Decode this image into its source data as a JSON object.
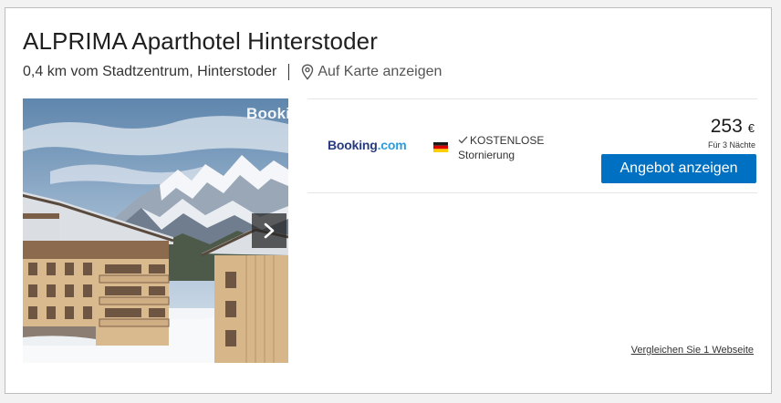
{
  "hotel": {
    "name": "ALPRIMA Aparthotel Hinterstoder",
    "distance": "0,4 km vom Stadtzentrum, Hinterstoder",
    "map_link": "Auf Karte anzeigen"
  },
  "photo": {
    "watermark": "Booki",
    "next_icon": "chevron-right-icon"
  },
  "offer": {
    "provider": {
      "name_main": "Booking",
      "name_suffix": ".com"
    },
    "flag": "germany-flag-icon",
    "cancellation_line1": "KOSTENLOSE",
    "cancellation_line2": "Stornierung",
    "price": "253",
    "currency": "€",
    "nights": "Für 3 Nächte",
    "button_label": "Angebot anzeigen"
  },
  "compare_link": "Vergleichen Sie 1 Webseite",
  "colors": {
    "button": "#0071c2",
    "booking_dark": "#273b7d",
    "booking_light": "#2b9cdd"
  }
}
